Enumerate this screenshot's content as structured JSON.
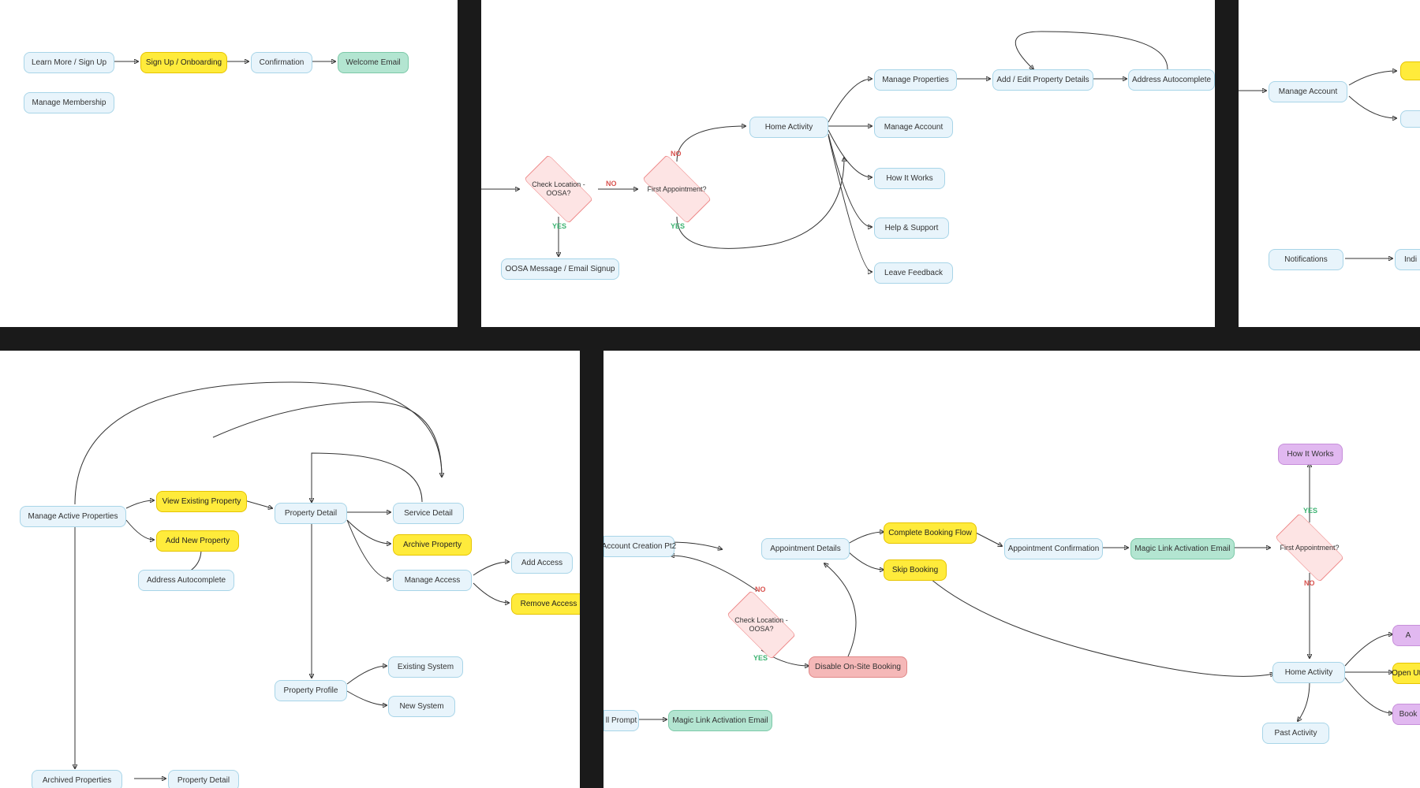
{
  "panels": {
    "p1": {
      "learnMore": "Learn More / Sign Up",
      "signup": "Sign Up / Onboarding",
      "confirmation": "Confirmation",
      "welcome": "Welcome Email",
      "manageMembership": "Manage Membership"
    },
    "p2": {
      "checkLocation": "Check\nLocation -\nOOSA?",
      "firstAppointment": "First\nAppointment?",
      "oosaMessage": "OOSA Message / Email Signup",
      "homeActivity": "Home Activity",
      "manageProperties": "Manage Properties",
      "addEditProperty": "Add / Edit Property Details",
      "addressAutocomplete": "Address Autocomplete",
      "manageAccount": "Manage Account",
      "howItWorks": "How It Works",
      "helpSupport": "Help & Support",
      "leaveFeedback": "Leave Feedback",
      "no": "NO",
      "yes": "YES"
    },
    "p3": {
      "manageAccount": "Manage Account",
      "notifications": "Notifications",
      "indi": "Indi"
    },
    "p4": {
      "manageActive": "Manage Active Properties",
      "viewExisting": "View Existing Property",
      "addNew": "Add New Property",
      "addressAutocomplete": "Address Autocomplete",
      "propertyDetail": "Property Detail",
      "serviceDetail": "Service Detail",
      "archiveProperty": "Archive Property",
      "manageAccess": "Manage Access",
      "addAccess": "Add Access",
      "removeAccess": "Remove Access",
      "propertyProfile": "Property Profile",
      "existingSystem": "Existing System",
      "newSystem": "New System",
      "archivedProperties": "Archived Properties",
      "propertyDetail2": "Property Detail"
    },
    "p5": {
      "accountCreation": "Account Creation Pt2",
      "appointmentDetails": "Appointment Details",
      "completeBooking": "Complete Booking Flow",
      "skipBooking": "Skip Booking",
      "appointmentConfirmation": "Appointment Confirmation",
      "magicLink": "Magic Link Activation Email",
      "howItWorks": "How It Works",
      "firstAppointment": "First\nAppointment?",
      "checkLocation": "Check\nLocation -\nOOSA?",
      "disableOnsite": "Disable On-Site Booking",
      "llPrompt": "ll Prompt",
      "magicLink2": "Magic Link Activation Email",
      "homeActivity": "Home Activity",
      "pastActivity": "Past Activity",
      "openUti": "Open Util",
      "book": "Book",
      "a": "A",
      "no": "NO",
      "yes": "YES"
    }
  }
}
